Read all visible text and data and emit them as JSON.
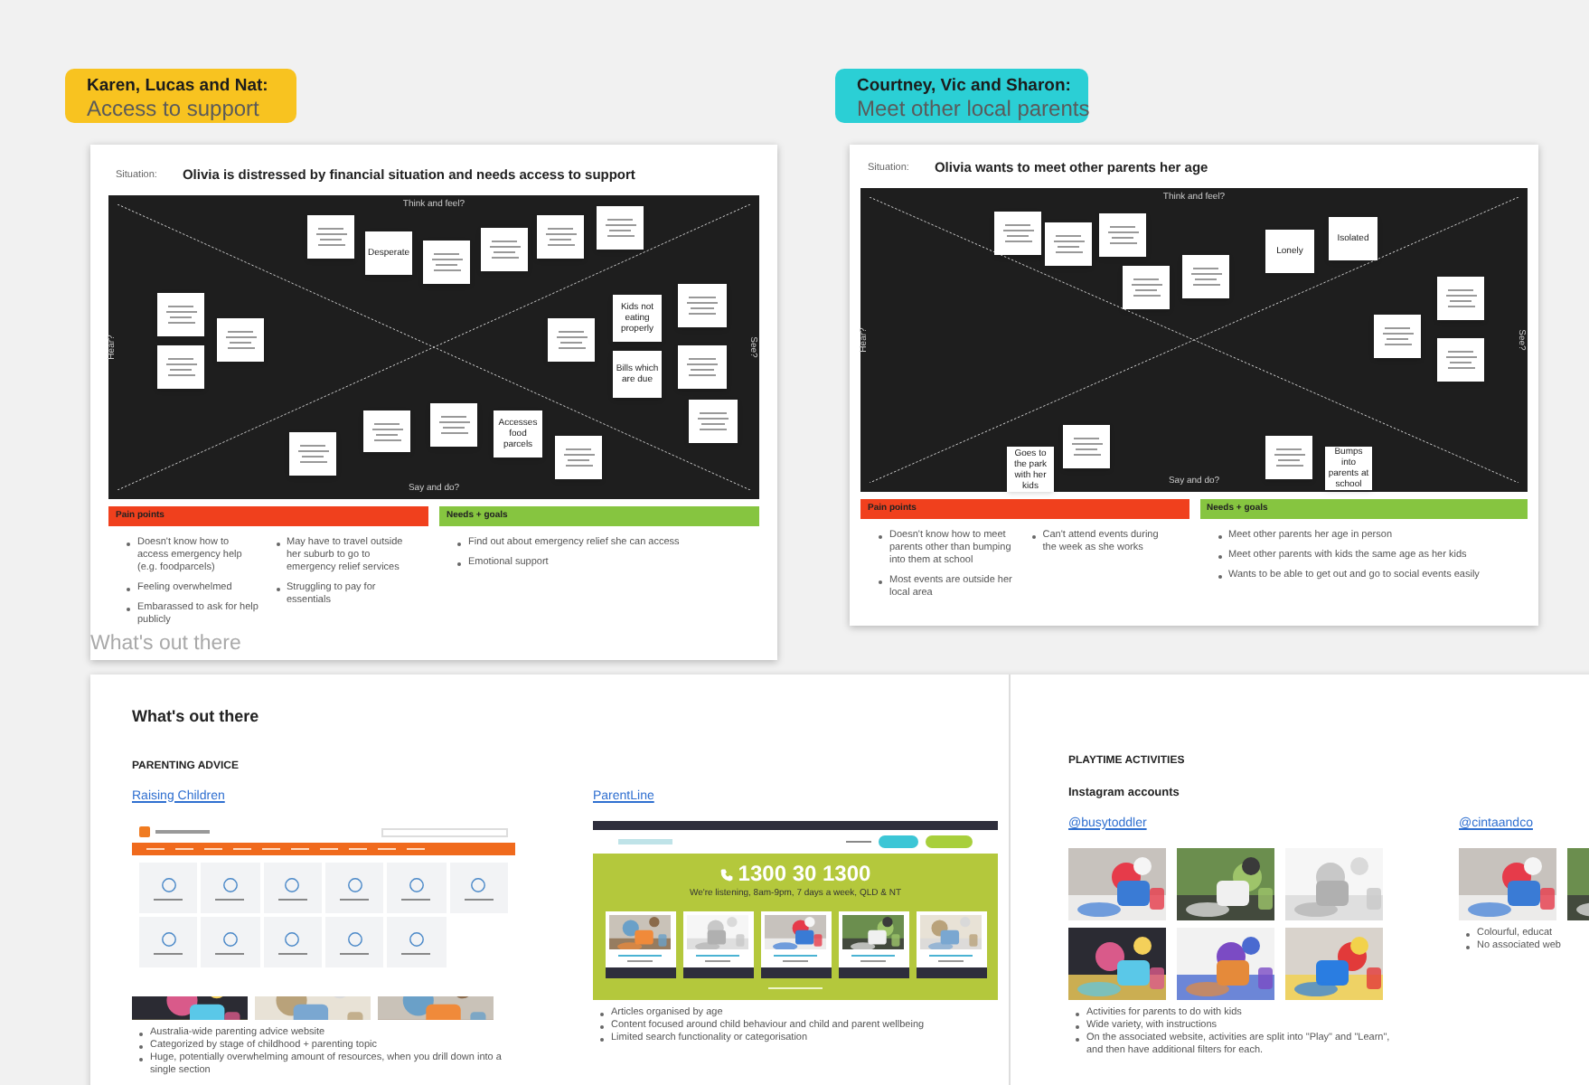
{
  "boards": [
    {
      "label": {
        "team": "Karen, Lucas and Nat:",
        "topic": "Access to support",
        "color": "#f8c320"
      },
      "situation_label": "Situation:",
      "situation": "Olivia is distressed by financial situation and needs access to support",
      "map": {
        "top": "Think and feel?",
        "bottom": "Say and do?",
        "left": "Hear?",
        "right": "See?",
        "stickies": [
          {
            "kind": "scribbled"
          },
          {
            "kind": "text",
            "text": "Desperate"
          },
          {
            "kind": "scribbled"
          },
          {
            "kind": "scribbled"
          },
          {
            "kind": "scribbled"
          },
          {
            "kind": "scribbled"
          },
          {
            "kind": "scribbled"
          },
          {
            "kind": "scribbled"
          },
          {
            "kind": "scribbled"
          },
          {
            "kind": "text",
            "text": "Kids not eating properly"
          },
          {
            "kind": "scribbled"
          },
          {
            "kind": "scribbled"
          },
          {
            "kind": "text",
            "text": "Bills which are due"
          },
          {
            "kind": "scribbled"
          },
          {
            "kind": "scribbled"
          },
          {
            "kind": "scribbled"
          },
          {
            "kind": "scribbled"
          },
          {
            "kind": "scribbled"
          },
          {
            "kind": "text",
            "text": "Accesses food parcels"
          },
          {
            "kind": "scribbled"
          }
        ]
      },
      "pain_points": {
        "title": "Pain points",
        "columns": [
          [
            "Doesn't know how to access emergency help (e.g. foodparcels)",
            "Feeling overwhelmed",
            "Embarassed to ask for help publicly"
          ],
          [
            "May have to travel outside her suburb to go to emergency relief services",
            "Struggling to pay for essentials"
          ]
        ]
      },
      "needs_goals": {
        "title": "Needs + goals",
        "items": [
          "Find out about emergency relief she can access",
          "Emotional support"
        ]
      }
    },
    {
      "label": {
        "team": "Courtney, Vic and Sharon:",
        "topic": "Meet other local parents",
        "color": "#2bcfd5"
      },
      "situation_label": "Situation:",
      "situation": "Olivia wants to meet other parents her age",
      "map": {
        "top": "Think and feel?",
        "bottom": "Say and do?",
        "left": "Hear?",
        "right": "See?",
        "stickies": [
          {
            "kind": "scribbled"
          },
          {
            "kind": "scribbled"
          },
          {
            "kind": "scribbled"
          },
          {
            "kind": "scribbled"
          },
          {
            "kind": "scribbled"
          },
          {
            "kind": "text",
            "text": "Lonely"
          },
          {
            "kind": "text",
            "text": "Isolated"
          },
          {
            "kind": "scribbled"
          },
          {
            "kind": "scribbled"
          },
          {
            "kind": "scribbled"
          },
          {
            "kind": "scribbled"
          },
          {
            "kind": "text",
            "text": "Goes to the park with her kids"
          },
          {
            "kind": "scribbled"
          },
          {
            "kind": "text",
            "text": "Bumps into parents at school"
          }
        ]
      },
      "pain_points": {
        "title": "Pain points",
        "columns": [
          [
            "Doesn't know how to meet parents other than bumping into them at school",
            "Most events are outside her local area"
          ],
          [
            "Can't attend events during the week as she works"
          ]
        ]
      },
      "needs_goals": {
        "title": "Needs + goals",
        "items": [
          "Meet other parents her age in person",
          "Meet other parents with kids the same age as her kids",
          "Wants to be able to get out and go to social events easily"
        ]
      }
    }
  ],
  "faded_heading": "What's out there",
  "out_there": {
    "title": "What's out there",
    "sections": [
      {
        "heading": "PARENTING ADVICE",
        "resources": [
          {
            "kind": "raising",
            "link": "Raising Children",
            "bullets": [
              "Australia-wide parenting advice website",
              "Categorized by stage of childhood + parenting topic",
              "Huge, potentially overwhelming amount of resources, when you drill down into a single section"
            ]
          },
          {
            "kind": "parentline",
            "link": "ParentLine",
            "phone": "1300 30 1300",
            "tagline": "We're listening, 8am-9pm, 7 days a week, QLD & NT",
            "bullets": [
              "Articles organised by age",
              "Content focused around child behaviour and child and parent wellbeing",
              "Limited search functionality or categorisation"
            ]
          }
        ]
      },
      {
        "heading": "PLAYTIME ACTIVITIES",
        "subheading": "Instagram accounts",
        "resources": [
          {
            "kind": "instagram",
            "link": "@busytoddler",
            "posts": [
              {
                "kind": "picture"
              },
              {
                "kind": "picture"
              },
              {
                "kind": "picture"
              },
              {
                "kind": "picture"
              },
              {
                "kind": "picture"
              },
              {
                "kind": "picture"
              }
            ],
            "bullets": [
              "Activities for parents to do with kids",
              "Wide variety, with instructions",
              "On the associated website, activities are split into \"Play\" and \"Learn\", and then have additional filters for each."
            ]
          },
          {
            "kind": "instagram",
            "link": "@cintaandco",
            "posts": [
              {
                "kind": "picture"
              },
              {
                "kind": "picture"
              }
            ],
            "bullets": [
              "Colourful, educat",
              "No associated web"
            ]
          }
        ]
      }
    ]
  }
}
